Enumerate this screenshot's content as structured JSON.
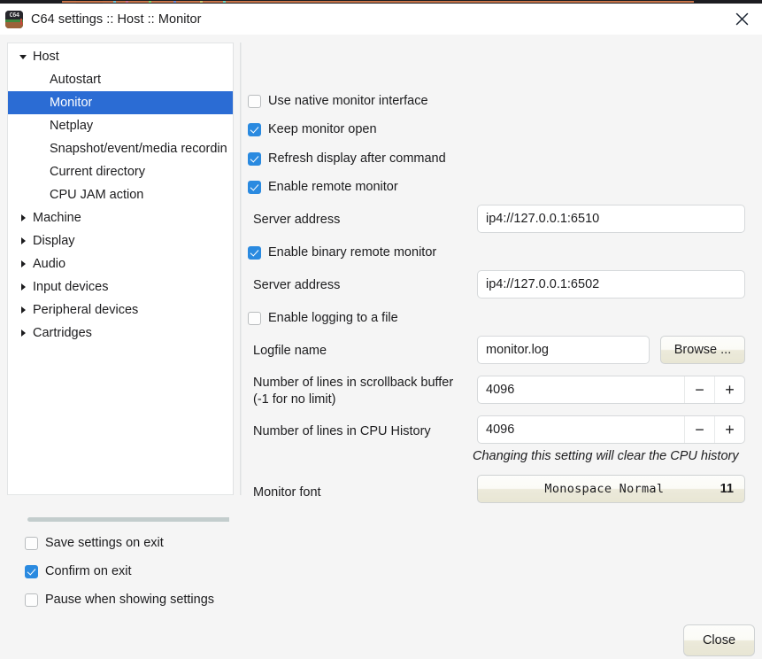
{
  "window": {
    "title": "C64 settings :: Host :: Monitor",
    "app_icon": "c64-app-icon",
    "icon_text": "C64",
    "close_icon": "close-icon"
  },
  "colors": {
    "selection": "#2b6cd4",
    "checkbox_on": "#2a8ae0",
    "window_bg": "#f5f5f5",
    "panel_bg": "#ffffff",
    "text": "#1c1c1e",
    "border": "#d6d9db"
  },
  "sidebar": {
    "items": [
      {
        "label": "Host",
        "level": 0,
        "expanded": true,
        "has_children": true,
        "selected": false
      },
      {
        "label": "Autostart",
        "level": 1,
        "expanded": false,
        "has_children": false,
        "selected": false
      },
      {
        "label": "Monitor",
        "level": 1,
        "expanded": false,
        "has_children": false,
        "selected": true
      },
      {
        "label": "Netplay",
        "level": 1,
        "expanded": false,
        "has_children": false,
        "selected": false
      },
      {
        "label": "Snapshot/event/media recordin",
        "level": 1,
        "expanded": false,
        "has_children": false,
        "selected": false
      },
      {
        "label": "Current directory",
        "level": 1,
        "expanded": false,
        "has_children": false,
        "selected": false
      },
      {
        "label": "CPU JAM action",
        "level": 1,
        "expanded": false,
        "has_children": false,
        "selected": false
      },
      {
        "label": "Machine",
        "level": 0,
        "expanded": false,
        "has_children": true,
        "selected": false
      },
      {
        "label": "Display",
        "level": 0,
        "expanded": false,
        "has_children": true,
        "selected": false
      },
      {
        "label": "Audio",
        "level": 0,
        "expanded": false,
        "has_children": true,
        "selected": false
      },
      {
        "label": "Input devices",
        "level": 0,
        "expanded": false,
        "has_children": true,
        "selected": false
      },
      {
        "label": "Peripheral devices",
        "level": 0,
        "expanded": false,
        "has_children": true,
        "selected": false
      },
      {
        "label": "Cartridges",
        "level": 0,
        "expanded": false,
        "has_children": true,
        "selected": false
      }
    ]
  },
  "settings": {
    "use_native_monitor": {
      "label": "Use native monitor interface",
      "checked": false
    },
    "keep_monitor_open": {
      "label": "Keep monitor open",
      "checked": true
    },
    "refresh_display": {
      "label": "Refresh display after command",
      "checked": true
    },
    "enable_remote": {
      "label": "Enable remote monitor",
      "checked": true
    },
    "server_address_1": {
      "label": "Server address",
      "value": "ip4://127.0.0.1:6510"
    },
    "enable_binary": {
      "label": "Enable binary remote monitor",
      "checked": true
    },
    "server_address_2": {
      "label": "Server address",
      "value": "ip4://127.0.0.1:6502"
    },
    "enable_logging": {
      "label": "Enable logging to a file",
      "checked": false
    },
    "logfile": {
      "label": "Logfile name",
      "value": "monitor.log",
      "browse_label": "Browse ..."
    },
    "scrollback": {
      "label_line1": "Number of lines in scrollback buffer",
      "label_line2": "(-1 for no limit)",
      "value": "4096",
      "decrement": "−",
      "increment": "+"
    },
    "cpu_history": {
      "label": "Number of lines in CPU History",
      "value": "4096",
      "decrement": "−",
      "increment": "+"
    },
    "cpu_history_note": "Changing this setting will clear the CPU history",
    "monitor_font": {
      "label": "Monitor font",
      "font_name": "Monospace Normal",
      "font_size": "11"
    }
  },
  "footer": {
    "save_on_exit": {
      "label": "Save settings on exit",
      "checked": false
    },
    "confirm_on_exit": {
      "label": "Confirm on exit",
      "checked": true
    },
    "pause_settings": {
      "label": "Pause when showing settings",
      "checked": false
    },
    "close_label": "Close"
  }
}
